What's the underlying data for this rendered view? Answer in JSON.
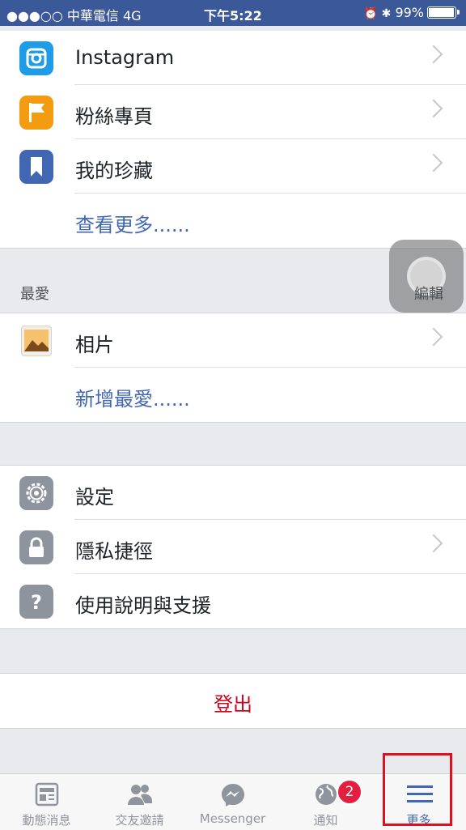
{
  "status_bar": {
    "carrier": "●●●○○ 中華電信  4G",
    "time": "下午5:22",
    "right": "99%"
  },
  "apps_section": {
    "items": [
      {
        "label": "Instagram",
        "icon": "instagram-icon",
        "color": "#1f9ce8",
        "chevron": true
      },
      {
        "label": "粉絲專頁",
        "icon": "flag-icon",
        "color": "#f39c12",
        "chevron": true
      },
      {
        "label": "我的珍藏",
        "icon": "bookmark-icon",
        "color": "#4267b2",
        "chevron": true
      }
    ],
    "see_more": "查看更多......"
  },
  "favorites": {
    "header": "最愛",
    "edit": "編輯",
    "items": [
      {
        "label": "相片",
        "icon": "photos-icon",
        "chevron": true
      }
    ],
    "add": "新增最愛......"
  },
  "settings_section": {
    "items": [
      {
        "label": "設定",
        "icon": "gear-icon",
        "color": "#8d949e",
        "chevron": false
      },
      {
        "label": "隱私捷徑",
        "icon": "lock-icon",
        "color": "#8d949e",
        "chevron": true
      },
      {
        "label": "使用說明與支援",
        "icon": "help-icon",
        "color": "#8d949e",
        "chevron": false
      }
    ]
  },
  "logout": "登出",
  "tabs": [
    {
      "label": "動態消息",
      "icon": "news-feed-icon"
    },
    {
      "label": "交友邀請",
      "icon": "friends-icon"
    },
    {
      "label": "Messenger",
      "icon": "messenger-icon"
    },
    {
      "label": "通知",
      "icon": "globe-icon",
      "badge": "2"
    },
    {
      "label": "更多",
      "icon": "menu-icon",
      "active": true
    }
  ],
  "colors": {
    "brand": "#3b5998",
    "link": "#4267b2",
    "logout": "#d0021b",
    "badge": "#e41e3f",
    "highlight": "#e0101e"
  }
}
